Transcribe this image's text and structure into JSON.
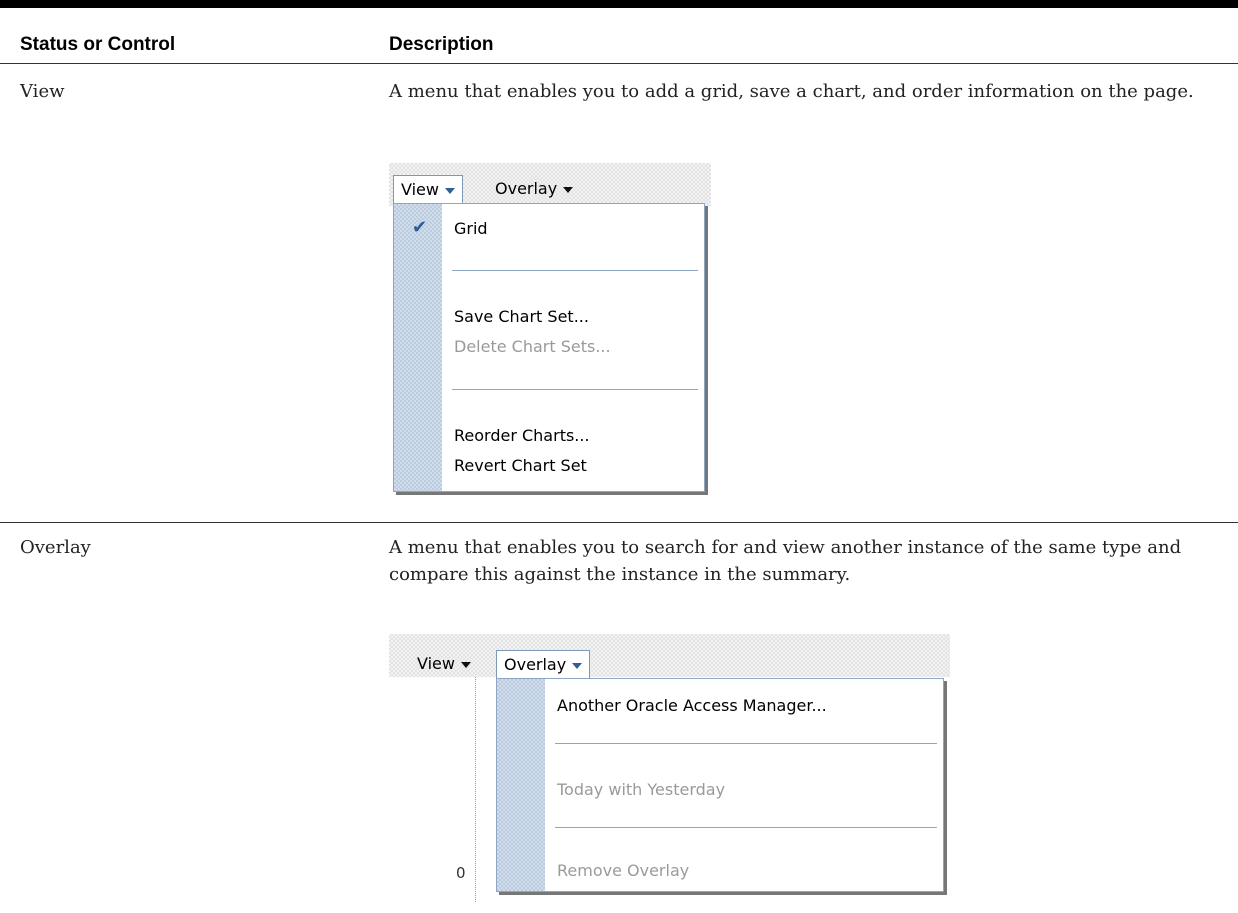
{
  "table": {
    "headers": [
      "Status or Control",
      "Description"
    ],
    "rows": [
      {
        "control": "View",
        "description": "A menu that enables you to add a grid, save a chart, and order information on the page.",
        "figure": {
          "toolbar": [
            "View",
            "Overlay"
          ],
          "open_menu": "View",
          "menu_items": [
            {
              "label": "Grid",
              "checked": true,
              "enabled": true
            },
            {
              "label": "Save Chart Set...",
              "enabled": true
            },
            {
              "label": "Delete Chart Sets...",
              "enabled": false
            },
            {
              "label": "Reorder Charts...",
              "enabled": true
            },
            {
              "label": "Revert Chart Set",
              "enabled": true
            }
          ]
        }
      },
      {
        "control": "Overlay",
        "description": "A menu that enables you to search for and view another instance of the same type and compare this against the instance in the summary.",
        "figure": {
          "toolbar": [
            "View",
            "Overlay"
          ],
          "open_menu": "Overlay",
          "menu_items": [
            {
              "label": "Another Oracle Access Manager...",
              "enabled": true
            },
            {
              "label": "Today with Yesterday",
              "enabled": false
            },
            {
              "label": "Remove Overlay",
              "enabled": false
            }
          ],
          "axis_label": "0"
        }
      }
    ]
  },
  "colors": {
    "menu_border": "#8ea6c2",
    "gutter": "#cfdceb",
    "check": "#2b5d95",
    "disabled_text": "#9a9a9a"
  },
  "icons": [
    "check-icon",
    "caret-down-icon"
  ]
}
